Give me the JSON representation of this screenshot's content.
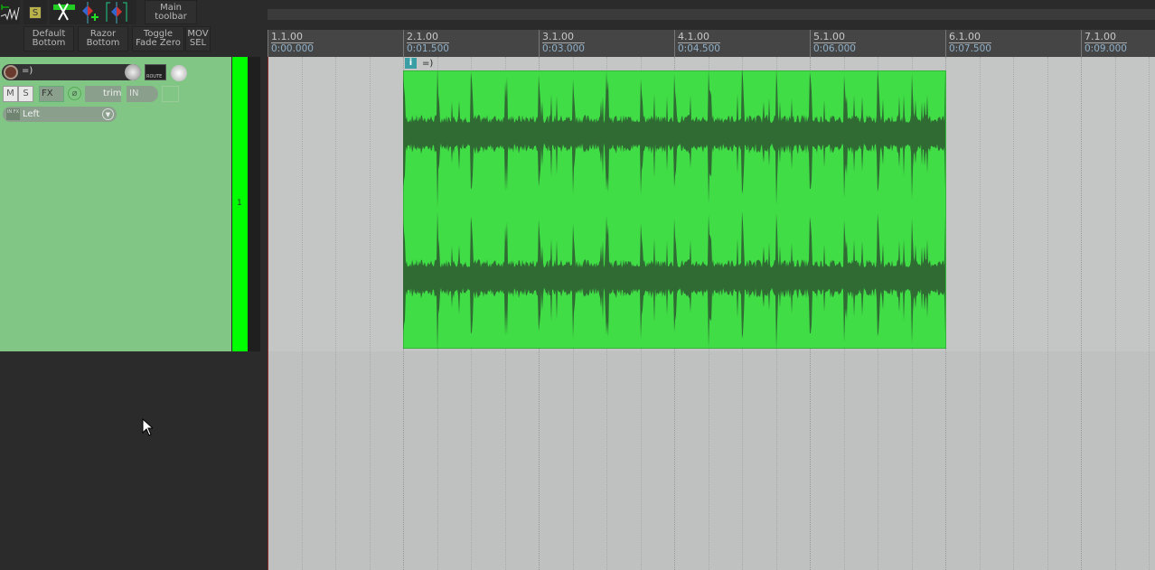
{
  "toolbar": {
    "row1": {
      "main_toolbar": "Main\ntoolbar",
      "solo_label": "S"
    },
    "row2": [
      "Default\nBottom",
      "Razor\nBottom",
      "Toggle\nFade Zero",
      "MOV\nSEL"
    ]
  },
  "ruler": {
    "marks": [
      {
        "bar": "1.1.00",
        "time": "0:00.000"
      },
      {
        "bar": "2.1.00",
        "time": "0:01.500"
      },
      {
        "bar": "3.1.00",
        "time": "0:03.000"
      },
      {
        "bar": "4.1.00",
        "time": "0:04.500"
      },
      {
        "bar": "5.1.00",
        "time": "0:06.000"
      },
      {
        "bar": "6.1.00",
        "time": "0:07.500"
      },
      {
        "bar": "7.1.00",
        "time": "0:09.000"
      }
    ]
  },
  "track": {
    "name": "=)",
    "number": "1",
    "mute": "M",
    "solo": "S",
    "fx": "FX",
    "trim": "trim",
    "input": "IN",
    "route": "ROUTE",
    "input_channel": "Left",
    "input_fx": "IN FX"
  },
  "item": {
    "name": "=)",
    "info": "i",
    "color": "#40dd46",
    "wave_color": "#2f6b33"
  },
  "colors": {
    "tcp": "#82c685",
    "meter": "#00ff00"
  }
}
